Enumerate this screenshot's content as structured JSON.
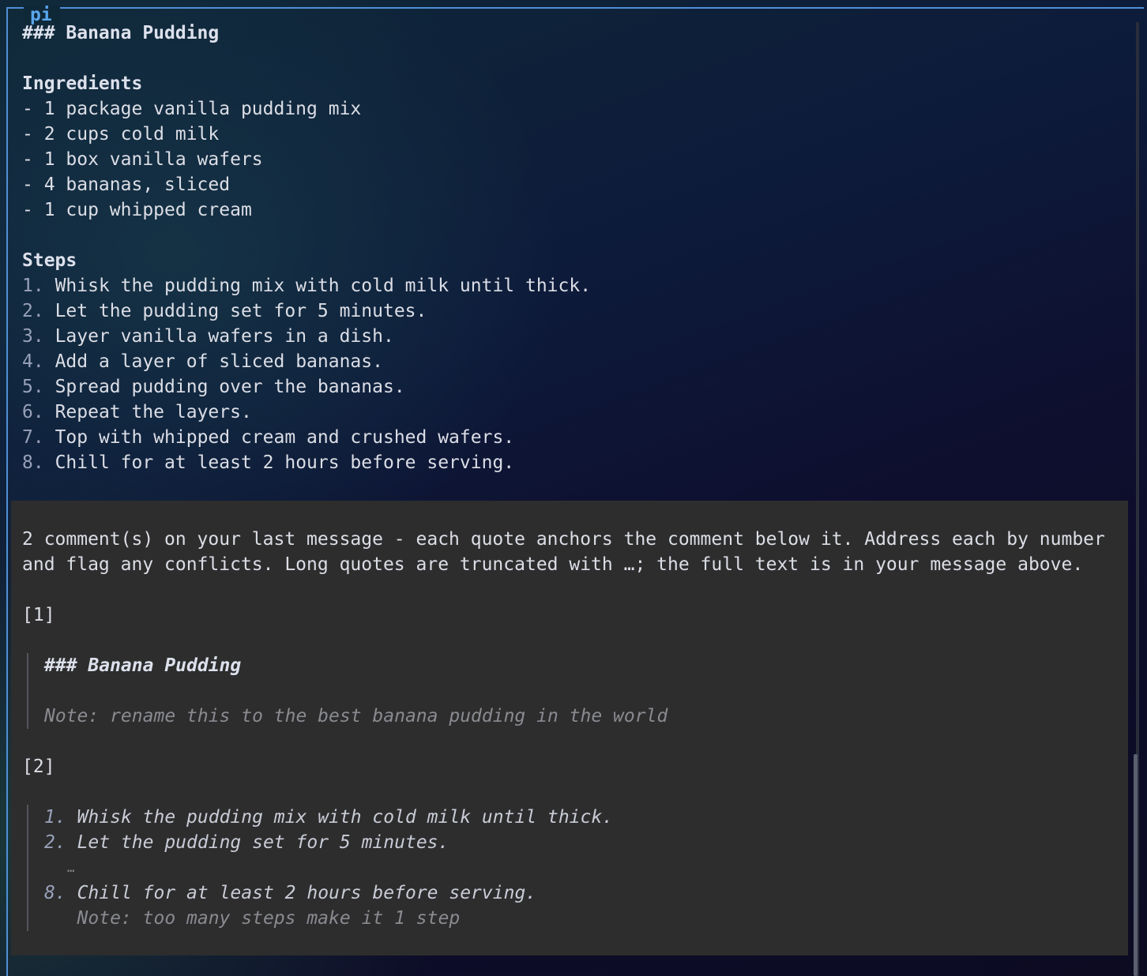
{
  "window": {
    "title": "pi"
  },
  "message": {
    "heading": "### Banana Pudding",
    "ingredients_title": "Ingredients",
    "ingredients": [
      "- 1 package vanilla pudding mix",
      "- 2 cups cold milk",
      "- 1 box vanilla wafers",
      "- 4 bananas, sliced",
      "- 1 cup whipped cream"
    ],
    "steps_title": "Steps",
    "steps": [
      {
        "num": "1.",
        "text": "Whisk the pudding mix with cold milk until thick."
      },
      {
        "num": "2.",
        "text": "Let the pudding set for 5 minutes."
      },
      {
        "num": "3.",
        "text": "Layer vanilla wafers in a dish."
      },
      {
        "num": "4.",
        "text": "Add a layer of sliced bananas."
      },
      {
        "num": "5.",
        "text": "Spread pudding over the bananas."
      },
      {
        "num": "6.",
        "text": "Repeat the layers."
      },
      {
        "num": "7.",
        "text": "Top with whipped cream and crushed wafers."
      },
      {
        "num": "8.",
        "text": "Chill for at least 2 hours before serving."
      }
    ]
  },
  "comments": {
    "intro_line1": "2 comment(s) on your last message - each quote anchors the comment below it. Address each by number",
    "intro_line2": "and flag any conflicts. Long quotes are truncated with …; the full text is in your message above.",
    "items": [
      {
        "label": "[1]",
        "quote_heading": "### Banana Pudding",
        "note": "Note: rename this to the best banana pudding in the world"
      },
      {
        "label": "[2]",
        "quote_lines": [
          {
            "num": "1.",
            "text": "Whisk the pudding mix with cold milk until thick."
          },
          {
            "num": "2.",
            "text": "Let the pudding set for 5 minutes."
          }
        ],
        "ellipsis": "…",
        "quote_last": {
          "num": "8.",
          "text": "Chill for at least 2 hours before serving."
        },
        "note": "Note: too many steps make it 1 step"
      }
    ]
  }
}
